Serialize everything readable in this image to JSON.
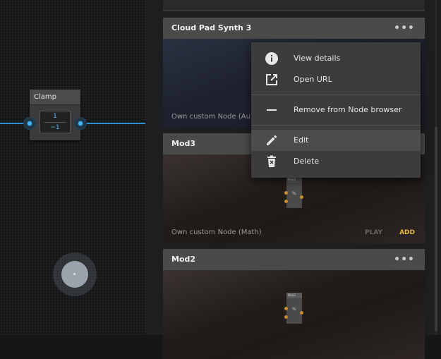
{
  "canvas": {
    "clamp_node": {
      "title": "Clamp",
      "value_top": "1",
      "value_bottom": "−1"
    }
  },
  "cards": [
    {
      "title": "Cloud Pad Synth 3",
      "subtitle": "Own custom Node (Au",
      "more_label": "•••"
    },
    {
      "title": "Mod3",
      "subtitle": "Own custom Node (Math)",
      "play_label": "PLAY",
      "add_label": "ADD",
      "mini_title": "Mod3",
      "mini_symbol": "%"
    },
    {
      "title": "Mod2",
      "more_label": "•••",
      "mini_title": "Mod2",
      "mini_symbol": "%"
    }
  ],
  "context_menu": {
    "items": [
      {
        "label": "View details",
        "icon": "info-icon"
      },
      {
        "label": "Open URL",
        "icon": "open-external-icon"
      },
      {
        "label": "Remove from Node browser",
        "icon": "minus-icon"
      },
      {
        "label": "Edit",
        "icon": "pencil-icon"
      },
      {
        "label": "Delete",
        "icon": "trash-icon"
      }
    ]
  },
  "colors": {
    "wire": "#2f8fd0",
    "port_glow": "#43b6ff",
    "add_accent": "#e8b93a",
    "mini_port": "#c88a2a"
  }
}
